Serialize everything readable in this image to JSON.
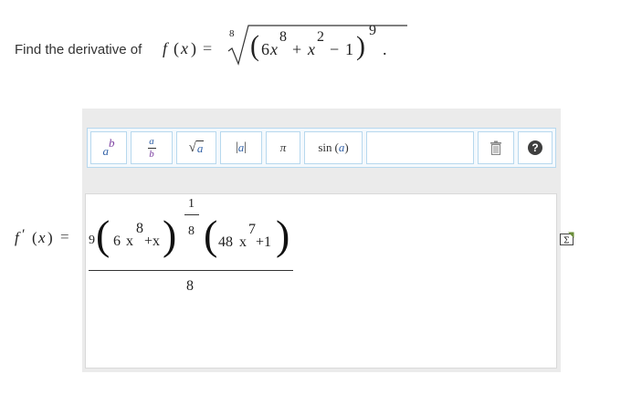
{
  "question": {
    "prompt": "Find the derivative of",
    "fname": "f",
    "var": "x",
    "root_index": "8",
    "poly_coeff": "6",
    "poly_exp1": "8",
    "poly_plus": "+",
    "poly_var2": "x",
    "poly_exp2": "2",
    "poly_minus": "−",
    "poly_const": "1",
    "outer_exp": "9",
    "end_punct": "."
  },
  "toolbar": {
    "buttons": [
      {
        "name": "superscript",
        "base": "a",
        "sup": "b"
      },
      {
        "name": "fraction",
        "num": "a",
        "den": "b"
      },
      {
        "name": "sqrt",
        "arg": "a"
      },
      {
        "name": "abs",
        "arg": "a"
      },
      {
        "name": "pi",
        "symbol": "π"
      },
      {
        "name": "sin",
        "func": "sin",
        "arg": "a"
      },
      {
        "name": "delete",
        "icon": "trash-icon"
      },
      {
        "name": "help",
        "symbol": "?"
      }
    ]
  },
  "answer": {
    "lhs_f": "f",
    "lhs_prime": "′",
    "lhs_var": "x",
    "equals": "=",
    "coef": "9",
    "t1_coeff": "6",
    "t1_var": "x",
    "t1_exp": "8",
    "t1_plus": "+x",
    "exp_num": "1",
    "exp_den": "8",
    "t2_coeff": "48",
    "t2_var": "x",
    "t2_exp": "7",
    "t2_plus": "+1",
    "denominator": "8"
  },
  "colors": {
    "toolbar_border": "#b7d8ee",
    "panel_bg": "#ebebeb",
    "help_bg": "#3f3f3f",
    "var_blue": "#3463a8",
    "var_purple": "#7b3fa0"
  }
}
